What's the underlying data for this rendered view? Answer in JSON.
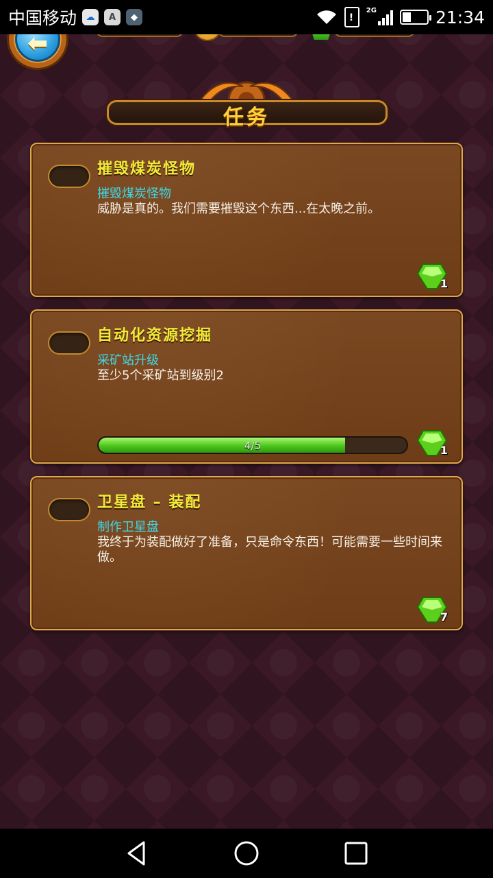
{
  "status_bar": {
    "carrier": "中国移动",
    "network": "2G",
    "time": "21:34",
    "battery_level": 0.36,
    "notification_icons": [
      "cloud-sync-icon",
      "font-app-icon",
      "shield-app-icon"
    ]
  },
  "screen": {
    "title": "任务"
  },
  "quests": [
    {
      "title": "摧毁煤炭怪物",
      "subtitle": "摧毁煤炭怪物",
      "description": "威胁是真的。我们需要摧毁这个东西...在太晚之前。",
      "reward_count": "1",
      "progress": null
    },
    {
      "title": "自动化资源挖掘",
      "subtitle": "采矿站升级",
      "description": "至少5个采矿站到级别2",
      "reward_count": "1",
      "progress": {
        "label": "4/5",
        "current": 4,
        "total": 5
      }
    },
    {
      "title": "卫星盘 – 装配",
      "subtitle": "制作卫星盘",
      "description": "我终于为装配做好了准备，只是命令东西！可能需要一些时间来做。",
      "reward_count": "7",
      "progress": null
    }
  ],
  "colors": {
    "quest_title": "#f2ea3a",
    "quest_subtitle": "#3fd8e8",
    "screen_title": "#ffd23a",
    "progress_fill": "#4cc61c",
    "card_border": "#e0a84a"
  }
}
